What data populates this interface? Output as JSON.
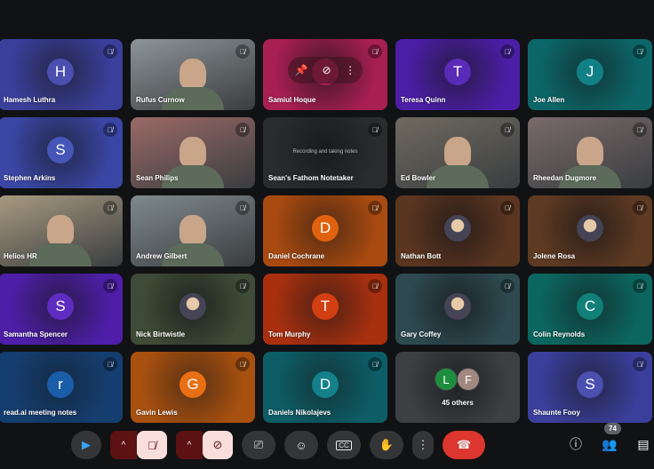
{
  "tiles": [
    {
      "name": "Hamesh Luthra",
      "kind": "avatar",
      "initial": "H",
      "bg": "#3b3f9c",
      "avatar": "#4a4fb0"
    },
    {
      "name": "Rufus Curnow",
      "kind": "video",
      "bg": "#8d9497"
    },
    {
      "name": "Samiul Hoque",
      "kind": "avatar-overlay",
      "initial": "",
      "bg": "#a81f52",
      "avatar": "#a81f52"
    },
    {
      "name": "Teresa Quinn",
      "kind": "avatar",
      "initial": "T",
      "bg": "#4b1ea6",
      "avatar": "#5a2ab8"
    },
    {
      "name": "Joe Allen",
      "kind": "avatar",
      "initial": "J",
      "bg": "#0c6668",
      "avatar": "#118086"
    },
    {
      "name": "Stephen Arkins",
      "kind": "avatar",
      "initial": "S",
      "bg": "#3a46a4",
      "avatar": "#4556b8"
    },
    {
      "name": "Sean Philips",
      "kind": "video",
      "bg": "#9a6a66"
    },
    {
      "name": "Sean's Fathom Notetaker",
      "kind": "note",
      "note": "Recording and taking notes",
      "bg": "#2a2b2d"
    },
    {
      "name": "Ed Bowler",
      "kind": "video",
      "bg": "#6f6a5f"
    },
    {
      "name": "Rheedan Dugmore",
      "kind": "video",
      "bg": "#7a6a6a"
    },
    {
      "name": "Helios HR",
      "kind": "video",
      "bg": "#a89a80"
    },
    {
      "name": "Andrew Gilbert",
      "kind": "video",
      "bg": "#7f8a8c"
    },
    {
      "name": "Daniel Cochrane",
      "kind": "avatar",
      "initial": "D",
      "bg": "#a84a10",
      "avatar": "#e0620f"
    },
    {
      "name": "Nathan Bott",
      "kind": "photo",
      "bg": "#5a3520"
    },
    {
      "name": "Jolene Rosa",
      "kind": "photo",
      "bg": "#5e3a22"
    },
    {
      "name": "Samantha Spencer",
      "kind": "avatar",
      "initial": "S",
      "bg": "#4e1ea8",
      "avatar": "#5e2cc0"
    },
    {
      "name": "Nick Birtwistle",
      "kind": "photo",
      "bg": "#3e4b36"
    },
    {
      "name": "Tom Murphy",
      "kind": "avatar",
      "initial": "T",
      "bg": "#a8300f",
      "avatar": "#d23f12"
    },
    {
      "name": "Gary Coffey",
      "kind": "photo",
      "bg": "#2e4a50"
    },
    {
      "name": "Colin Reynolds",
      "kind": "avatar",
      "initial": "C",
      "bg": "#0c6660",
      "avatar": "#118078"
    },
    {
      "name": "read.ai meeting notes",
      "kind": "avatar",
      "initial": "r",
      "bg": "#153e70",
      "avatar": "#1a5da8"
    },
    {
      "name": "Gavin Lewis",
      "kind": "avatar",
      "initial": "G",
      "bg": "#a8500f",
      "avatar": "#e86f14"
    },
    {
      "name": "Daniels Nikolajevs",
      "kind": "avatar",
      "initial": "D",
      "bg": "#0d5d66",
      "avatar": "#13808a"
    },
    {
      "name": "45 others",
      "kind": "others",
      "initials": [
        "L",
        "F"
      ],
      "bg": "#3c4043"
    },
    {
      "name": "Shaunte Fooy",
      "kind": "avatar",
      "initial": "S",
      "bg": "#3b3f9c",
      "avatar": "#4a4fb0"
    }
  ],
  "overlay": {
    "pin": "pin-icon",
    "mute": "mute-icon",
    "more": "more-icon"
  },
  "controls": {
    "apps": "apps-icon",
    "mic": "mic-off-icon",
    "camera": "camera-off-icon",
    "present": "present-icon",
    "emoji": "emoji-icon",
    "captions": "captions-icon",
    "hand": "raise-hand-icon",
    "more": "more-icon",
    "leave": "leave-call-icon"
  },
  "right": {
    "participants_count": "74"
  },
  "colors": {
    "leave": "#dc362e",
    "muted_bg": "#5c1212",
    "muted_fg": "#f9dedc"
  }
}
